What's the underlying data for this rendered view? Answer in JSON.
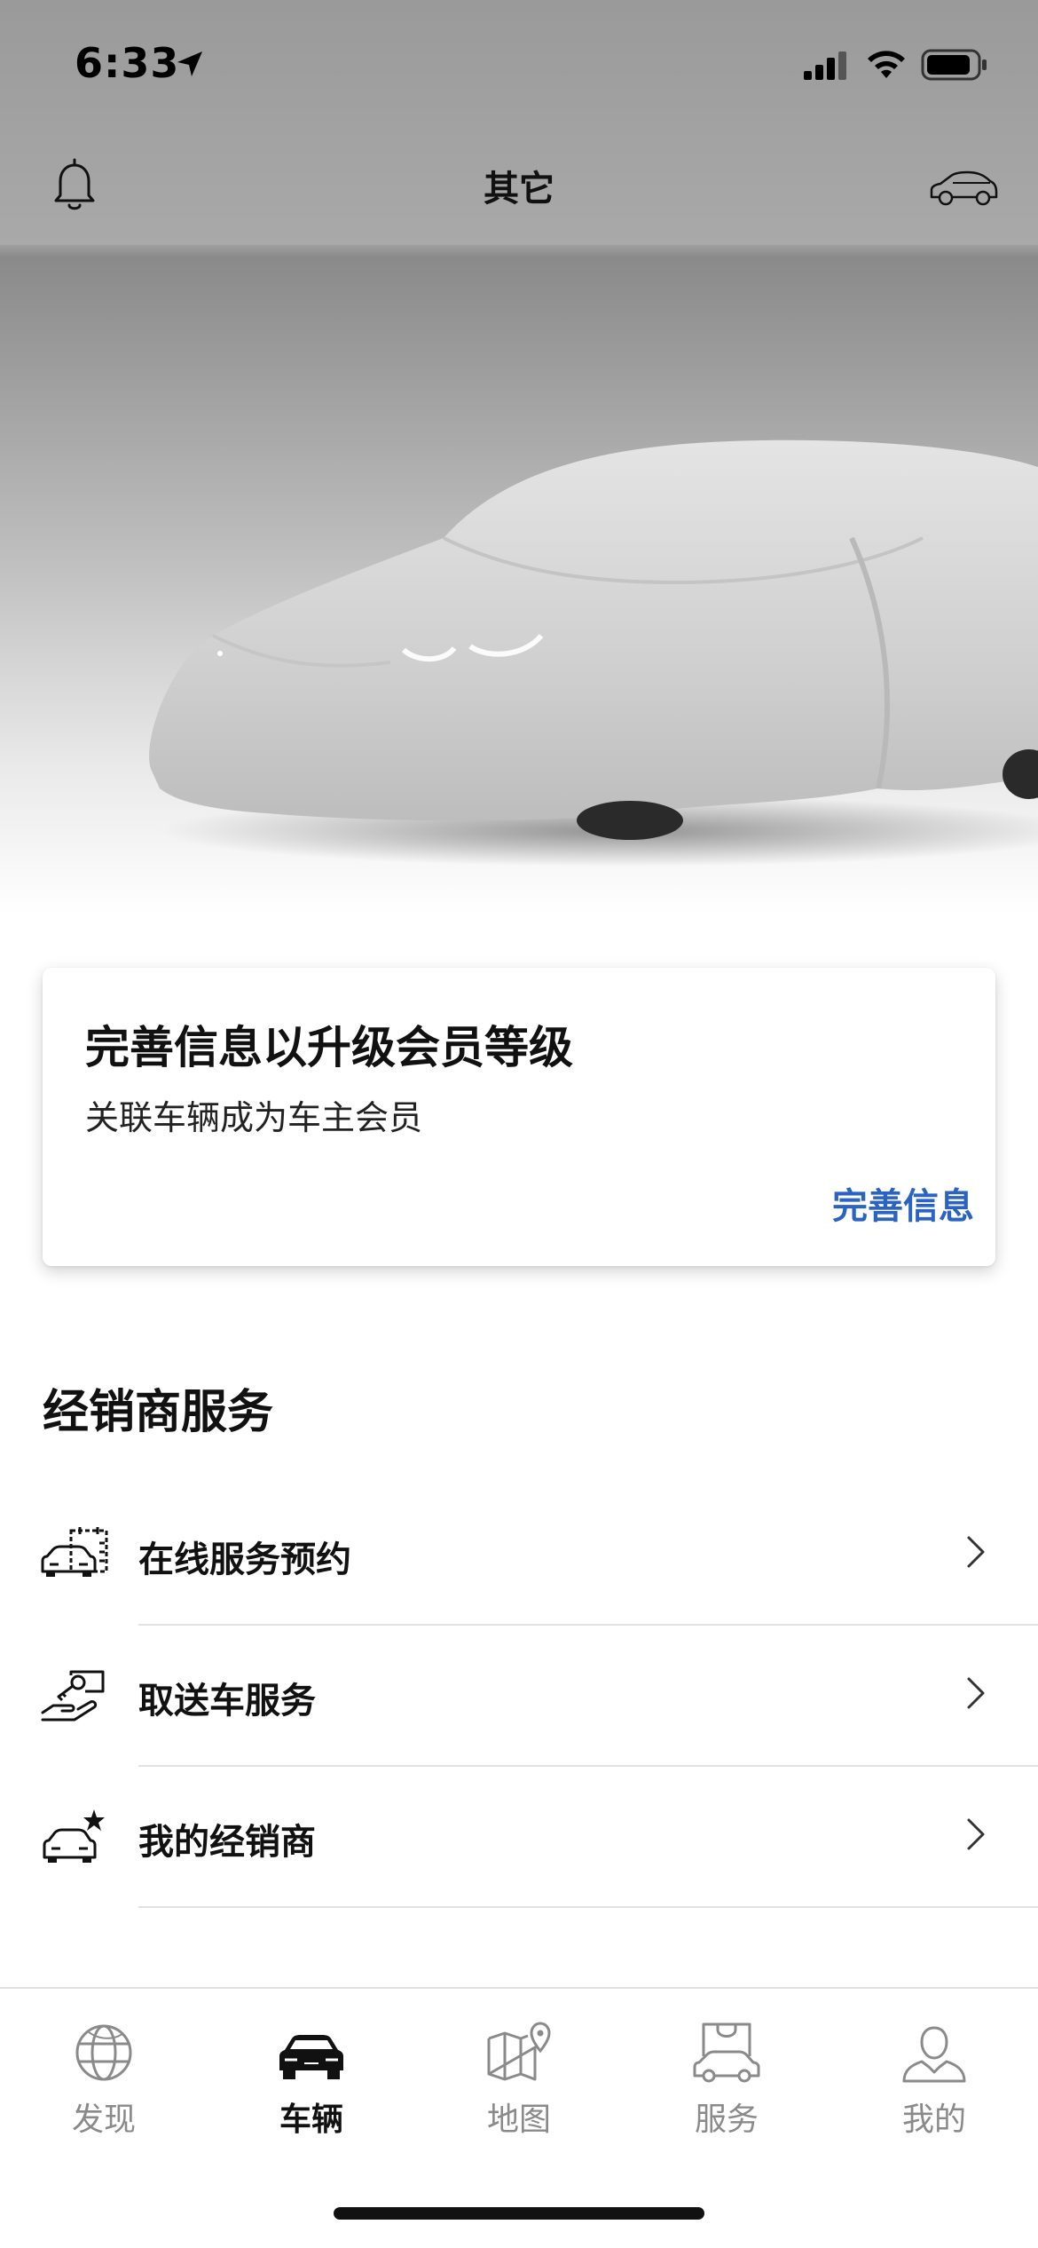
{
  "status_bar": {
    "time": "6:33",
    "icons": [
      "location-arrow-icon",
      "cellular-signal-icon",
      "wifi-icon",
      "battery-icon"
    ]
  },
  "navbar": {
    "title": "其它",
    "left_icon": "bell-icon",
    "right_icon": "car-switch-icon"
  },
  "hero": {
    "image": "covered-car-image"
  },
  "card": {
    "title": "完善信息以升级会员等级",
    "subtitle": "关联车辆成为车主会员",
    "link_label": "完善信息",
    "link_color": "#2b63c3"
  },
  "dealer_section": {
    "title": "经销商服务",
    "items": [
      {
        "label": "在线服务预约",
        "icon": "service-appointment-icon"
      },
      {
        "label": "取送车服务",
        "icon": "car-pickup-delivery-icon"
      },
      {
        "label": "我的经销商",
        "icon": "my-dealer-icon"
      }
    ]
  },
  "tabbar": {
    "tabs": [
      {
        "label": "发现",
        "icon": "globe-icon",
        "active": false
      },
      {
        "label": "车辆",
        "icon": "car-icon",
        "active": true
      },
      {
        "label": "地图",
        "icon": "map-icon",
        "active": false
      },
      {
        "label": "服务",
        "icon": "shopping-bag-car-icon",
        "active": false
      },
      {
        "label": "我的",
        "icon": "user-icon",
        "active": false
      }
    ]
  }
}
